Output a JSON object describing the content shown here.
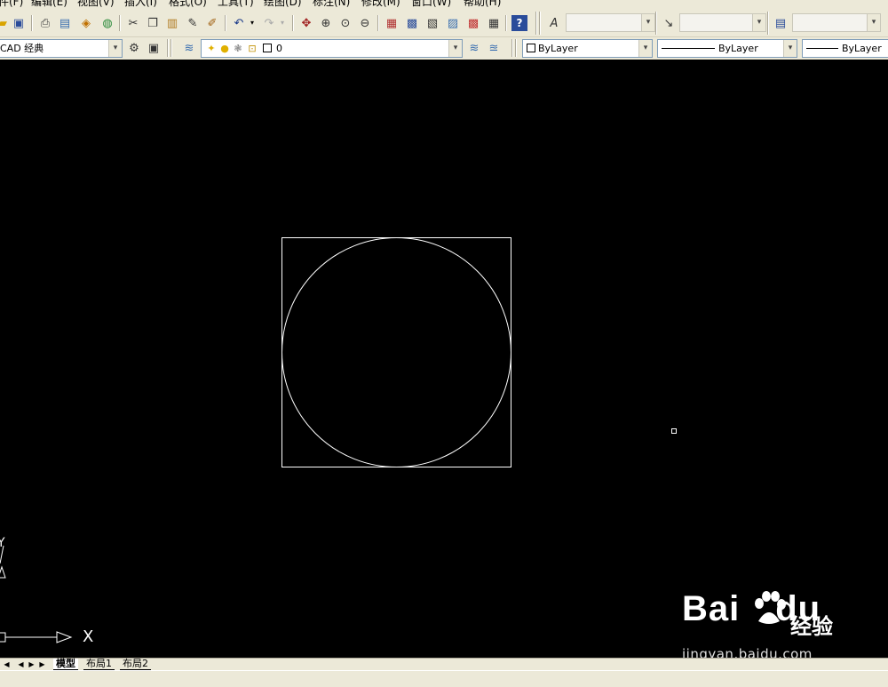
{
  "menu": [
    {
      "label": "件(F)"
    },
    {
      "label": "编辑(E)"
    },
    {
      "label": "视图(V)"
    },
    {
      "label": "插入(I)"
    },
    {
      "label": "格式(O)"
    },
    {
      "label": "工具(T)"
    },
    {
      "label": "绘图(D)"
    },
    {
      "label": "标注(N)"
    },
    {
      "label": "修改(M)"
    },
    {
      "label": "窗口(W)"
    },
    {
      "label": "帮助(H)"
    }
  ],
  "toolbar_icons": [
    "folder-icon",
    "save-icon",
    "print-icon",
    "plot-preview-icon",
    "publish-icon",
    "globe-icon",
    "cut-icon",
    "copy-icon",
    "paste-icon",
    "match-properties-icon",
    "brush-icon",
    "undo-icon",
    "undo-dropdown-icon",
    "redo-icon",
    "redo-dropdown-icon",
    "pan-icon",
    "zoom-realtime-icon",
    "zoom-window-icon",
    "zoom-previous-icon",
    "properties-icon",
    "design-center-icon",
    "tool-palettes-icon",
    "sheet-set-icon",
    "markup-icon",
    "calculator-icon",
    "help-icon",
    "text-style-icon",
    "dimension-style-icon",
    "table-style-icon"
  ],
  "workspace": {
    "value": "CAD 经典"
  },
  "layer": {
    "value": "0"
  },
  "properties": {
    "color": "ByLayer",
    "linetype": "ByLayer",
    "lineweight": "ByLayer"
  },
  "tabs": [
    {
      "label": "模型",
      "active": true
    },
    {
      "label": "布局1",
      "active": false
    },
    {
      "label": "布局2",
      "active": false
    }
  ],
  "ucs": {
    "x_label": "X",
    "y_label": "Y"
  },
  "watermark": {
    "logo": "Bai",
    "logo_suffix": "du",
    "cn": "经验",
    "url": "jingyan.baidu.com"
  },
  "colors": {
    "canvas": "#000000",
    "entity": "#ffffff",
    "chrome": "#ece9d8"
  }
}
